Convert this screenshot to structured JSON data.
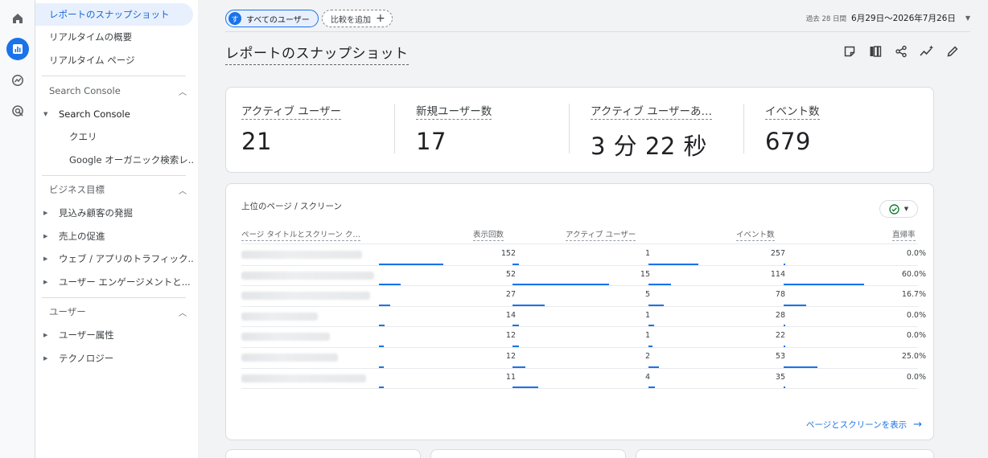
{
  "rail": {
    "items": [
      "home-icon",
      "reports-icon",
      "explore-icon",
      "advertising-icon"
    ]
  },
  "nav": {
    "top_items": [
      "レポートのスナップショット",
      "リアルタイムの概要",
      "リアルタイム ページ"
    ],
    "sections": [
      {
        "title": "Search Console",
        "group": "Search Console",
        "children": [
          "クエリ",
          "Google オーガニック検索レ..."
        ]
      },
      {
        "title": "ビジネス目標",
        "items": [
          "見込み顧客の発掘",
          "売上の促進",
          "ウェブ / アプリのトラフィック...",
          "ユーザー エンゲージメントと..."
        ]
      },
      {
        "title": "ユーザー",
        "items": [
          "ユーザー属性",
          "テクノロジー"
        ]
      }
    ]
  },
  "topbar": {
    "avatar_letter": "す",
    "all_users": "すべてのユーザー",
    "add_comparison": "比較を追加",
    "date_prefix": "過去 28 日間",
    "date_range": "6月29日〜2026年7月26日"
  },
  "page": {
    "title": "レポートのスナップショット"
  },
  "toolbar": [
    "note-icon",
    "compare-icon",
    "share-icon",
    "insights-icon",
    "edit-icon"
  ],
  "metrics": [
    {
      "label": "アクティブ ユーザー",
      "value": "21"
    },
    {
      "label": "新規ユーザー数",
      "value": "17"
    },
    {
      "label": "アクティブ ユーザーあ…",
      "value": "3 分 22 秒"
    },
    {
      "label": "イベント数",
      "value": "679"
    }
  ],
  "table": {
    "title": "上位のページ / スクリーン",
    "headers": [
      "ページ タイトルとスクリーン ク…",
      "表示回数",
      "アクティブ ユーザー",
      "イベント数",
      "直帰率"
    ],
    "rows": [
      {
        "views": "152",
        "users": "1",
        "events": "257",
        "bounce": "0.0%"
      },
      {
        "views": "52",
        "users": "15",
        "events": "114",
        "bounce": "60.0%"
      },
      {
        "views": "27",
        "users": "5",
        "events": "78",
        "bounce": "16.7%"
      },
      {
        "views": "14",
        "users": "1",
        "events": "28",
        "bounce": "0.0%"
      },
      {
        "views": "12",
        "users": "1",
        "events": "22",
        "bounce": "0.0%"
      },
      {
        "views": "12",
        "users": "2",
        "events": "53",
        "bounce": "25.0%"
      },
      {
        "views": "11",
        "users": "4",
        "events": "35",
        "bounce": "0.0%"
      }
    ],
    "link": "ページとスクリーンを表示"
  },
  "colors": {
    "accent": "#1a73e8",
    "success": "#188038"
  }
}
